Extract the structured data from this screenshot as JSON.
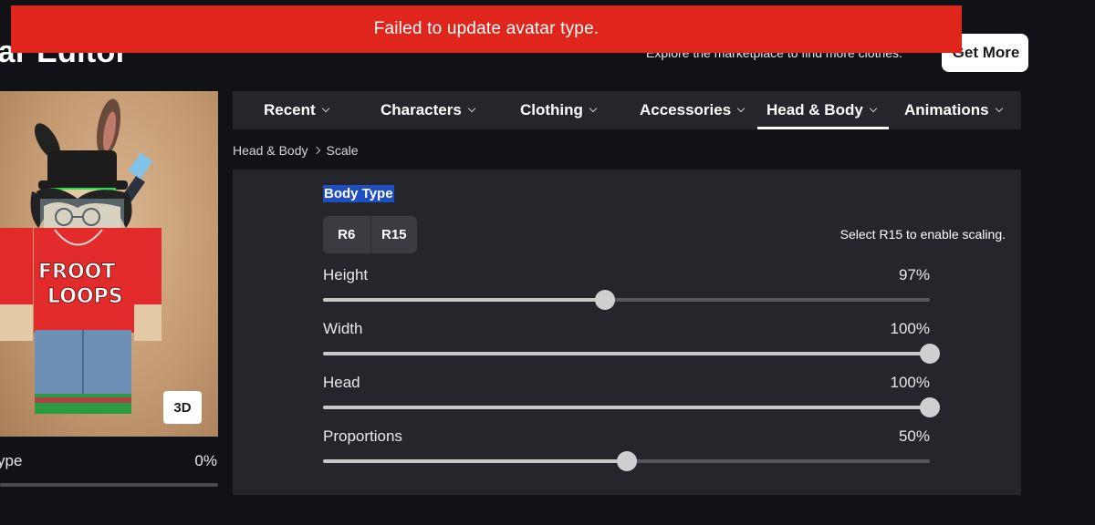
{
  "header": {
    "title": "tar Editor",
    "subtitle": "Explore the marketplace to find more clothes.",
    "get_more_label": "Get More"
  },
  "toast": {
    "message": "Failed to update avatar type.",
    "color": "#e0251d"
  },
  "preview": {
    "view_toggle_label": "3D",
    "partial_slider": {
      "label": "ype",
      "value": "0%",
      "level": 0
    }
  },
  "tabs": [
    {
      "label": "Recent",
      "active": false
    },
    {
      "label": "Characters",
      "active": false
    },
    {
      "label": "Clothing",
      "active": false
    },
    {
      "label": "Accessories",
      "active": false
    },
    {
      "label": "Head & Body",
      "active": true
    },
    {
      "label": "Animations",
      "active": false
    }
  ],
  "breadcrumb": {
    "parent": "Head & Body",
    "current": "Scale"
  },
  "body_type": {
    "title": "Body Type",
    "options": [
      "R6",
      "R15"
    ],
    "selected": "R6",
    "hint": "Select R15 to enable scaling."
  },
  "sliders": [
    {
      "label": "Height",
      "value": "97%",
      "level": 0.465
    },
    {
      "label": "Width",
      "value": "100%",
      "level": 1.0
    },
    {
      "label": "Head",
      "value": "100%",
      "level": 1.0
    },
    {
      "label": "Proportions",
      "value": "50%",
      "level": 0.5
    }
  ],
  "colors": {
    "background": "#111216",
    "panel": "#24262b",
    "accent_highlight": "#1e4fc2",
    "error": "#e0251d"
  }
}
